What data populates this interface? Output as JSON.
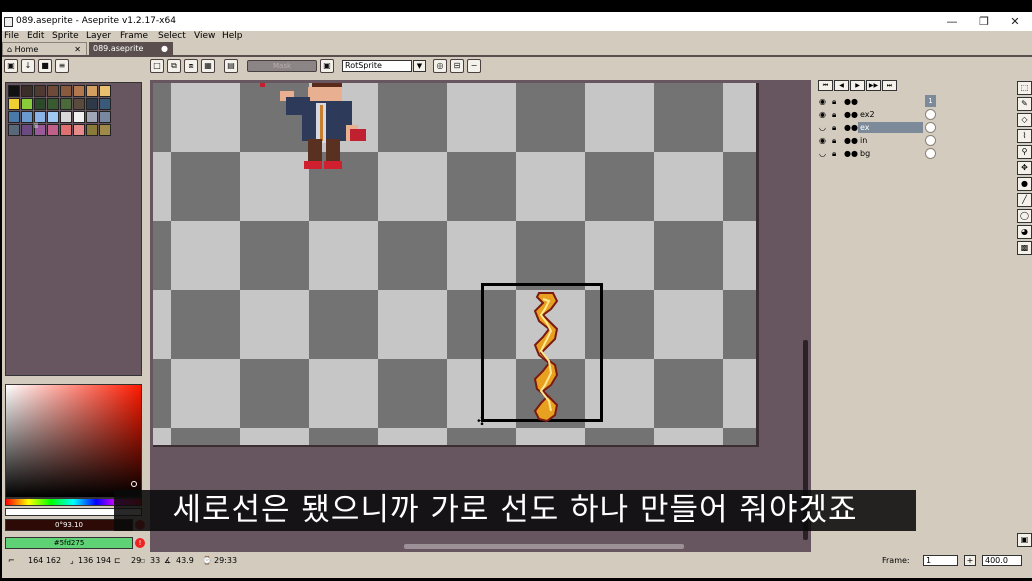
{
  "window": {
    "title": "089.aseprite - Aseprite v1.2.17-x64",
    "minimize": "—",
    "maximize": "❐",
    "close": "✕"
  },
  "menu": [
    "File",
    "Edit",
    "Sprite",
    "Layer",
    "Frame",
    "Select",
    "View",
    "Help"
  ],
  "tabs": {
    "home": "Home",
    "file": "089.aseprite",
    "home_close": "✕",
    "file_close": "●"
  },
  "toolbar": {
    "mask_label": "Mask",
    "rotation_algorithm": "RotSprite"
  },
  "color_bar": {
    "fg_color_text": "0°93.10",
    "bg_color_text": "#5fd275",
    "warning": "!",
    "palette_index_label": "ll",
    "palette": [
      "#111111",
      "#3a2e2a",
      "#4e3a30",
      "#6e4a3a",
      "#8a5a3e",
      "#b0784c",
      "#d4a060",
      "#e8c070",
      "#f0d030",
      "#8acb3a",
      "#2a4a2a",
      "#3a5a32",
      "#4a6a3a",
      "#5a4a3e",
      "#2e3a4a",
      "#3a5a7a",
      "#4a7aa8",
      "#6a9ad0",
      "#8ab4e8",
      "#a0c8f0",
      "#d8d8d8",
      "#f0f0f0",
      "#a0a8b8",
      "#7888a0",
      "#586878",
      "#6a4a80",
      "#9a5a9a",
      "#c0608a",
      "#e07070",
      "#e88a8a",
      "#8a7a3a",
      "#a08a4a"
    ]
  },
  "frame_controls": [
    "⏮",
    "◀",
    "▶",
    "▶▶",
    "⏭"
  ],
  "layers": [
    {
      "name": "",
      "visible": true,
      "active": false,
      "frame_num": "1"
    },
    {
      "name": "ex2",
      "visible": true,
      "active": false
    },
    {
      "name": "ex",
      "visible": false,
      "active": true
    },
    {
      "name": "in",
      "visible": true,
      "active": false
    },
    {
      "name": "bg",
      "visible": false,
      "active": false
    }
  ],
  "status": {
    "pos": "164 162",
    "size": "136 194",
    "frame_num": "29",
    "sel_info": "33",
    "angle": "43.9",
    "time": "29:33",
    "frame_label": "Frame:",
    "frame_value": "1",
    "zoom_value": "400.0"
  },
  "subtitle": "세로선은 됐으니까 가로 선도 하나 만들어 줘야겠죠",
  "colors": {
    "workspace_bg": "#675660",
    "panel_bg": "#d3cbbe",
    "active_layer": "#7c8a99",
    "fg_color": "#2d0a05",
    "bg_color": "#5fd275"
  }
}
